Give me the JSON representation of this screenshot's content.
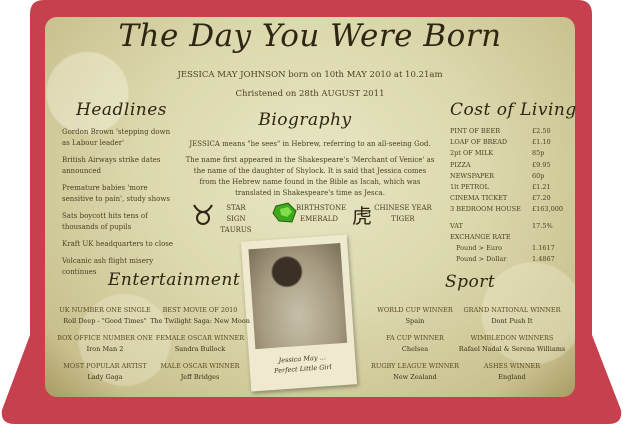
{
  "title": "The Day You Were Born",
  "subtitle": "JESSICA MAY JOHNSON born on 10th MAY 2010 at 10.21am",
  "christened": "Christened on 28th AUGUST 2011",
  "headlines": {
    "heading": "Headlines",
    "items": [
      "Gordon Brown 'stepping down as Labour leader'",
      "British Airways strike dates announced",
      "Premature babies 'more sensitive to pain', study shows",
      "Sats boycott hits tens of thousands of pupils",
      "Kraft UK headquarters to close",
      "Volcanic ash flight misery continues"
    ]
  },
  "biography": {
    "heading": "Biography",
    "meaning": "JESSICA means \"he sees\" in Hebrew, referring to an all-seeing God.",
    "paragraph": "The name first appeared in the Shakespeare's 'Merchant of Venice' as the name of the daughter of Shylock. It is said that Jessica comes from the Hebrew name found in the Bible as Iscah, which was translated in Shakespeare's time as Jesca.",
    "star_sign": {
      "label": "STAR SIGN",
      "value": "TAURUS",
      "icon": "taurus-icon"
    },
    "birthstone": {
      "label": "BIRTHSTONE",
      "value": "EMERALD",
      "icon": "emerald-icon",
      "color": "#3fa81e"
    },
    "chinese_year": {
      "label": "CHINESE YEAR",
      "value": "TIGER",
      "icon": "tiger-character-icon",
      "glyph": "虎"
    }
  },
  "cost_of_living": {
    "heading": "Cost of Living",
    "rows": [
      {
        "item": "PINT OF BEER",
        "price": "£2.50"
      },
      {
        "item": "LOAF OF BREAD",
        "price": "£1.10"
      },
      {
        "item": "2pt OF MILK",
        "price": "85p"
      },
      {
        "item": "PIZZA",
        "price": "£9.95"
      },
      {
        "item": "NEWSPAPER",
        "price": "60p"
      },
      {
        "item": "1lt PETROL",
        "price": "£1.21"
      },
      {
        "item": "CINEMA TICKET",
        "price": "£7.20"
      },
      {
        "item": "3 BEDROOM HOUSE",
        "price": "£163,000"
      }
    ],
    "vat": {
      "label": "VAT",
      "value": "17.5%"
    },
    "exchange": {
      "label": "EXCHANGE RATE",
      "rows": [
        {
          "item": "Pound > Euro",
          "value": "1.1617"
        },
        {
          "item": "Pound > Dollar",
          "value": "1.4867"
        }
      ]
    }
  },
  "entertainment": {
    "heading": "Entertainment",
    "items": [
      {
        "label": "UK NUMBER ONE SINGLE",
        "value": "Roll Deep - \"Good Times\""
      },
      {
        "label": "BEST MOVIE OF 2010",
        "value": "The Twilight Saga: New Moon"
      },
      {
        "label": "BOX OFFICE NUMBER ONE",
        "value": "Iron Man 2"
      },
      {
        "label": "FEMALE OSCAR WINNER",
        "value": "Sandra Bullock"
      },
      {
        "label": "MOST POPULAR ARTIST",
        "value": "Lady Gaga"
      },
      {
        "label": "MALE OSCAR WINNER",
        "value": "Jeff Bridges"
      }
    ]
  },
  "sport": {
    "heading": "Sport",
    "items": [
      {
        "label": "WORLD CUP WINNER",
        "value": "Spain"
      },
      {
        "label": "GRAND NATIONAL WINNER",
        "value": "Dont Push It"
      },
      {
        "label": "FA CUP WINNER",
        "value": "Chelsea"
      },
      {
        "label": "WIMBLEDON WINNERS",
        "value": "Rafael Nadal & Serena Williams"
      },
      {
        "label": "RUGBY LEAGUE WINNER",
        "value": "New Zealand"
      },
      {
        "label": "ASHES WINNER",
        "value": "England"
      }
    ]
  },
  "photo": {
    "caption_line1": "Jessica May ...",
    "caption_line2": "Perfect Little Girl"
  },
  "colors": {
    "frame": "#c6404d",
    "ink": "#4a3f22"
  }
}
